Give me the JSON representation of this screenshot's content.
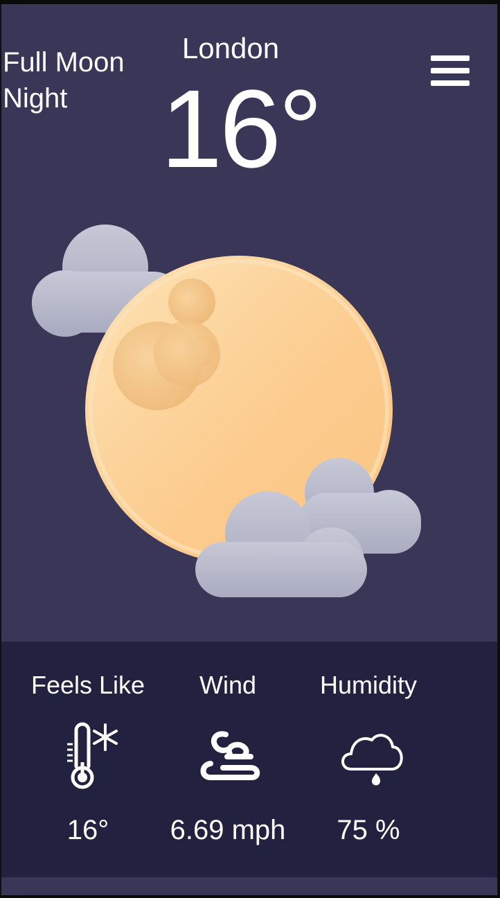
{
  "header": {
    "condition": "Full Moon Night",
    "city": "London",
    "temperature": "16°"
  },
  "hero_icon": "moon-with-clouds-icon",
  "stats": {
    "feels_like": {
      "label": "Feels Like",
      "value": "16°",
      "icon": "thermometer-snowflake-icon"
    },
    "wind": {
      "label": "Wind",
      "value": "6.69 mph",
      "icon": "wind-icon"
    },
    "humidity": {
      "label": "Humidity",
      "value": "75 %",
      "icon": "cloud-raindrop-icon"
    }
  },
  "colors": {
    "background": "#393657",
    "stats_panel": "#222240",
    "moon": "#FDD9A0",
    "cloud": "#B7B9CB"
  }
}
